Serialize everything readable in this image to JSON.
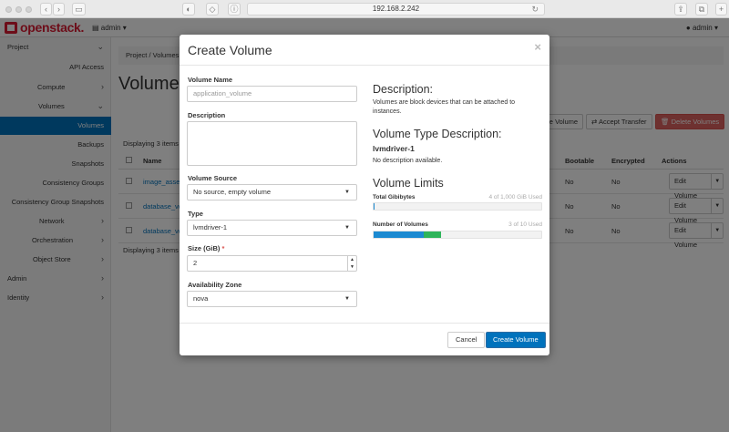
{
  "browser": {
    "url": "192.168.2.242"
  },
  "header": {
    "logo": "openstack.",
    "project_selector": "admin",
    "user_menu": "admin"
  },
  "sidebar": {
    "items": [
      {
        "label": "Project",
        "chevron": true
      },
      {
        "label": "API Access"
      },
      {
        "label": "Compute",
        "chevron": true
      },
      {
        "label": "Volumes",
        "chevron": true
      },
      {
        "label": "Volumes",
        "active": true
      },
      {
        "label": "Backups"
      },
      {
        "label": "Snapshots"
      },
      {
        "label": "Consistency Groups"
      },
      {
        "label": "Consistency Group Snapshots"
      },
      {
        "label": "Network",
        "chevron": true
      },
      {
        "label": "Orchestration",
        "chevron": true
      },
      {
        "label": "Object Store",
        "chevron": true
      },
      {
        "label": "Admin",
        "chevron": true
      },
      {
        "label": "Identity",
        "chevron": true
      }
    ]
  },
  "main": {
    "breadcrumb_project": "Project",
    "breadcrumb_sep": "/",
    "breadcrumb_volumes": "Volumes",
    "title": "Volumes",
    "displaying_top": "Displaying 3 items",
    "displaying_bottom": "Displaying 3 items",
    "create_volume_btn": "Create Volume",
    "accept_transfer_btn": "Accept Transfer",
    "delete_volumes_btn": "Delete Volumes",
    "columns": {
      "name": "Name",
      "bootable": "Bootable",
      "encrypted": "Encrypted",
      "actions": "Actions"
    },
    "rows": [
      {
        "name": "image_asset",
        "bootable": "No",
        "encrypted": "No",
        "action": "Edit Volume"
      },
      {
        "name": "database_vo",
        "bootable": "No",
        "encrypted": "No",
        "action": "Edit Volume"
      },
      {
        "name": "database_vo",
        "bootable": "No",
        "encrypted": "No",
        "action": "Edit Volume"
      }
    ]
  },
  "modal": {
    "title": "Create Volume",
    "close": "×",
    "volume_name_label": "Volume Name",
    "volume_name_placeholder": "application_volume",
    "description_label": "Description",
    "volume_source_label": "Volume Source",
    "volume_source_value": "No source, empty volume",
    "type_label": "Type",
    "type_value": "lvmdriver-1",
    "size_label": "Size (GiB)",
    "size_required": "*",
    "size_value": "2",
    "az_label": "Availability Zone",
    "az_value": "nova",
    "desc_heading": "Description:",
    "desc_text": "Volumes are block devices that can be attached to instances.",
    "vtd_heading": "Volume Type Description:",
    "vtd_name": "lvmdriver-1",
    "vtd_text": "No description available.",
    "limits_heading": "Volume Limits",
    "quota_gib_label": "Total Gibibytes",
    "quota_gib_value": "4 of 1,000 GiB Used",
    "quota_gib_fraction": 0.004,
    "quota_vol_label": "Number of Volumes",
    "quota_vol_value": "3 of 10 Used",
    "quota_vol_used_fraction": 0.3,
    "quota_vol_new_fraction": 0.1,
    "cancel_btn": "Cancel",
    "create_btn": "Create Volume"
  },
  "colors": {
    "brand": "#da1a32",
    "primary": "#0072bc",
    "danger": "#d9534f",
    "quota_used": "#1c8ad1",
    "quota_new": "#2fb45a"
  },
  "icons": {
    "close": "close-icon",
    "dropdown": "caret-down-icon",
    "chevron": "chevron-right-icon",
    "spinner": "spinner-arrows-icon"
  }
}
